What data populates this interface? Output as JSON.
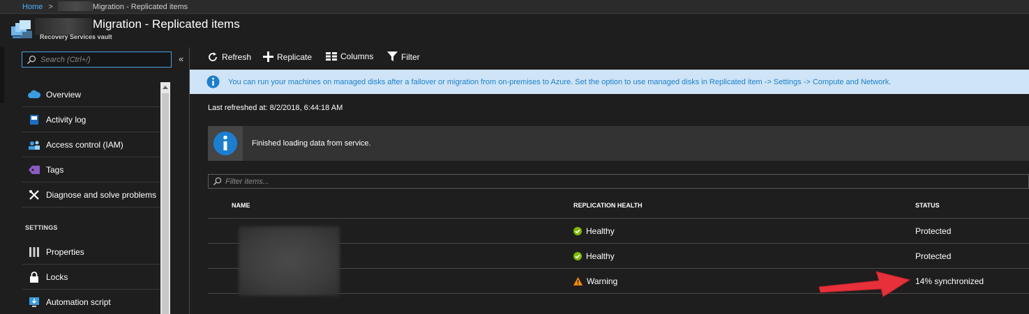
{
  "breadcrumb": {
    "home": "Home",
    "separator": ">",
    "current": "Migration - Replicated items"
  },
  "blade": {
    "title": "Migration - Replicated items",
    "subtitle": "Recovery Services vault"
  },
  "sidebar": {
    "search_placeholder": "Search (Ctrl+/)",
    "collapse_glyph": "«",
    "items": [
      {
        "label": "Overview",
        "icon": "cloud-icon"
      },
      {
        "label": "Activity log",
        "icon": "activity-log-icon"
      },
      {
        "label": "Access control (IAM)",
        "icon": "people-icon"
      },
      {
        "label": "Tags",
        "icon": "tag-icon"
      },
      {
        "label": "Diagnose and solve problems",
        "icon": "wrench-icon"
      }
    ],
    "settings_header": "SETTINGS",
    "settings_items": [
      {
        "label": "Properties",
        "icon": "properties-icon"
      },
      {
        "label": "Locks",
        "icon": "lock-icon"
      },
      {
        "label": "Automation script",
        "icon": "automation-icon"
      }
    ]
  },
  "toolbar": {
    "refresh": "Refresh",
    "replicate": "Replicate",
    "columns": "Columns",
    "filter": "Filter"
  },
  "banner": {
    "text": "You can run your machines on managed disks after a failover or migration from on-premises to Azure. Set the option to use managed disks in Replicated item -> Settings -> Compute and Network."
  },
  "last_refreshed": "Last refreshed at: 8/2/2018, 6:44:18 AM",
  "notification": "Finished loading data from service.",
  "filter_placeholder": "Filter items...",
  "grid": {
    "columns": {
      "name": "NAME",
      "health": "REPLICATION HEALTH",
      "status": "STATUS"
    },
    "rows": [
      {
        "health": "Healthy",
        "health_state": "ok",
        "status": "Protected"
      },
      {
        "health": "Healthy",
        "health_state": "ok",
        "status": "Protected"
      },
      {
        "health": "Warning",
        "health_state": "warning",
        "status": "14% synchronized"
      }
    ]
  },
  "colors": {
    "accent_blue": "#1b7fd1",
    "healthy_green": "#7fba00",
    "warning_orange": "#ff8c00",
    "annotation_red": "#e8303a"
  }
}
